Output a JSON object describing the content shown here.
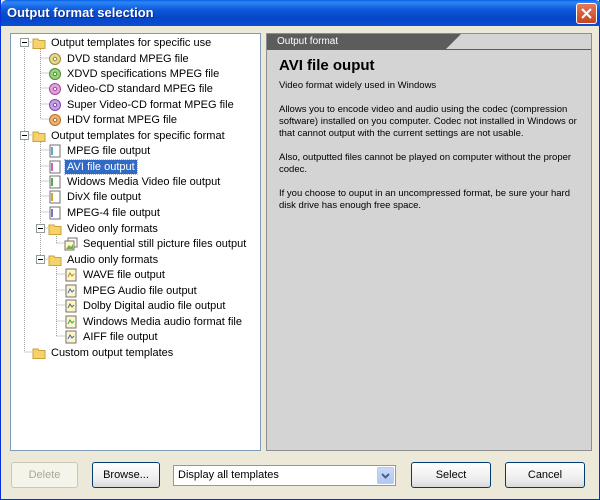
{
  "window": {
    "title": "Output format selection"
  },
  "tree": {
    "nodes": [
      {
        "label": "Output templates for specific use",
        "icon": "folder-icon"
      },
      {
        "label": "DVD standard MPEG file",
        "icon": "disc-icon"
      },
      {
        "label": "XDVD specifications MPEG file",
        "icon": "disc-icon"
      },
      {
        "label": "Video-CD standard MPEG file",
        "icon": "disc-icon"
      },
      {
        "label": "Super Video-CD format MPEG file",
        "icon": "disc-icon"
      },
      {
        "label": "HDV format MPEG file",
        "icon": "disc-icon"
      },
      {
        "label": "Output templates for specific format",
        "icon": "folder-icon"
      },
      {
        "label": "MPEG file output",
        "icon": "video-file-icon"
      },
      {
        "label": "AVI file output",
        "icon": "video-file-icon"
      },
      {
        "label": "Widows Media Video file output",
        "icon": "video-file-icon"
      },
      {
        "label": "DivX file output",
        "icon": "video-file-icon"
      },
      {
        "label": "MPEG-4 file output",
        "icon": "video-file-icon"
      },
      {
        "label": "Video only formats",
        "icon": "folder-icon"
      },
      {
        "label": "Sequential still picture files output",
        "icon": "image-sequence-icon"
      },
      {
        "label": "Audio only formats",
        "icon": "folder-icon"
      },
      {
        "label": "WAVE file output",
        "icon": "audio-file-icon"
      },
      {
        "label": "MPEG Audio file output",
        "icon": "audio-file-icon"
      },
      {
        "label": "Dolby Digital audio file output",
        "icon": "audio-file-icon"
      },
      {
        "label": "Windows Media audio format file",
        "icon": "audio-file-icon"
      },
      {
        "label": "AIFF file output",
        "icon": "audio-file-icon"
      },
      {
        "label": "Custom output templates",
        "icon": "folder-icon"
      }
    ],
    "selected": "AVI file output"
  },
  "description": {
    "header": "Output format",
    "title": "AVI file ouput",
    "paragraphs": [
      "Video format widely used in Windows",
      "Allows you to encode video and audio using the codec (compression software) installed on you computer. Codec not installed in Windows or that cannot output with the current settings are not usable.",
      "Also, outputted files cannot be played on computer without the proper codec.",
      "If you choose to ouput in an uncompressed format, be sure your hard disk drive has enough free space."
    ]
  },
  "footer": {
    "delete_label": "Delete",
    "browse_label": "Browse...",
    "filter_value": "Display all templates",
    "select_label": "Select",
    "cancel_label": "Cancel"
  },
  "colors": {
    "title_bar": "#0c56d8",
    "selection": "#316ac5",
    "folder": "#f5d26a"
  }
}
